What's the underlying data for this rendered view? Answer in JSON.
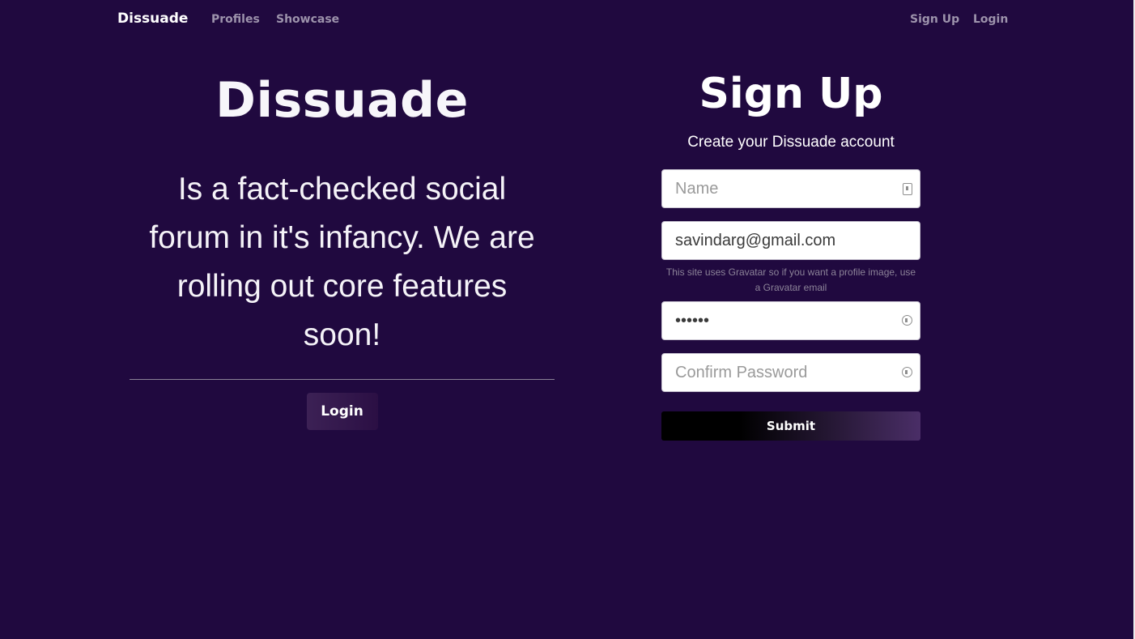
{
  "navbar": {
    "brand": "Dissuade",
    "links": [
      "Profiles",
      "Showcase"
    ],
    "right_links": [
      "Sign Up",
      "Login"
    ]
  },
  "hero": {
    "title": "Dissuade",
    "text": "Is a fact-checked social forum in it's infancy. We are rolling out core features soon!",
    "login_button": "Login"
  },
  "signup": {
    "title": "Sign Up",
    "lead": "Create your Dissuade account",
    "name_placeholder": "Name",
    "email_value": "savindarg@gmail.com",
    "email_help": "This site uses Gravatar so if you want a profile image, use a Gravatar email",
    "password_value": "••••••",
    "confirm_placeholder": "Confirm Password",
    "submit_label": "Submit"
  },
  "colors": {
    "background": "#20093f",
    "nav_link": "#9d93ac",
    "help_text": "#8c8398"
  },
  "icons": {
    "name_field": "contact-card-icon",
    "password_field": "key-icon",
    "confirm_field": "key-icon"
  }
}
